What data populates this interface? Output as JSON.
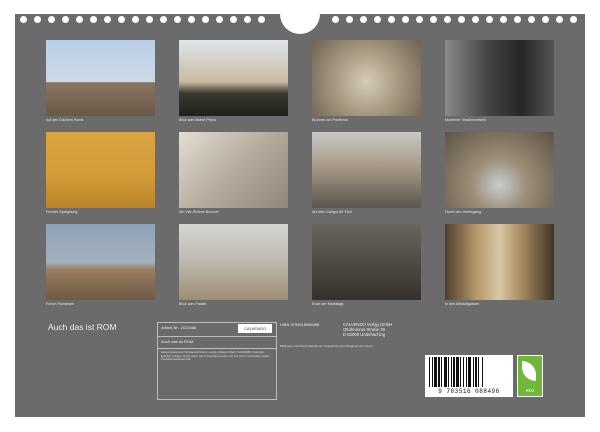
{
  "calendar": {
    "title": "Auch das ist ROM",
    "article_label": "Artikel-Nr.: 2023486",
    "subtitle": "Auch das ist ROM",
    "publisher_logo": "CALVENDO",
    "isbn": "ISBN 9783516088496",
    "vendor_lines": [
      "CALVENDO Verlag GmbH",
      "Ottobrunner Straße 39",
      "D-82008 Unterhaching"
    ],
    "description": "Einige besonderer Schnappschüsse in ewigen Ewigen Stadt. CALVENDO Kalender lieferbar solange Vorrat reicht. Alle Fotografien wurden mit viel Liebe zum Detail erstellt. Produktionsstandort DE.",
    "credits": "Bildquelle: http://www.calvendo.de Originalfotos auf Anfrage bei der Autorin.",
    "barcode_number": "9 783516 088496",
    "eco_label": "eco"
  },
  "photos": [
    {
      "caption": "Auf den Dächern Roms"
    },
    {
      "caption": "Blick vom Monte Pincio"
    },
    {
      "caption": "Brunnen am Pantheon"
    },
    {
      "caption": "Moderner Straßenverkehr"
    },
    {
      "caption": "Fenster-Spiegelung"
    },
    {
      "caption": "Am Vier-Ströme-Brunnen"
    },
    {
      "caption": "Auf dem Campo de' Fiori"
    },
    {
      "caption": "Durch den Hofeingang"
    },
    {
      "caption": "Forum Romanum"
    },
    {
      "caption": "Blick vom Palatin"
    },
    {
      "caption": "Ende der Markttags"
    },
    {
      "caption": "In den Altstadtgassen"
    }
  ]
}
